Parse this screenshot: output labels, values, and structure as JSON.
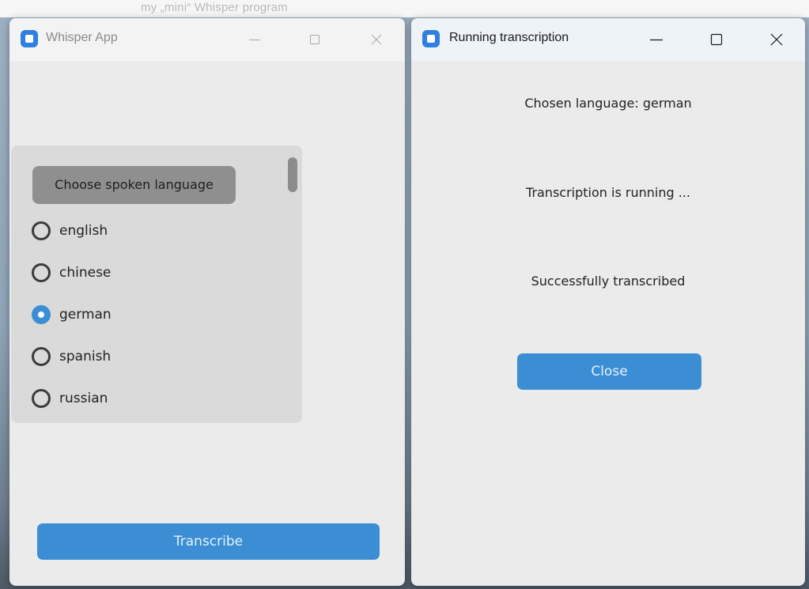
{
  "background_strip": {
    "text": "my „mini“ Whisper program"
  },
  "main_window": {
    "title": "Whisper App",
    "language_panel": {
      "header": "Choose spoken language",
      "options": [
        {
          "label": "english",
          "selected": false
        },
        {
          "label": "chinese",
          "selected": false
        },
        {
          "label": "german",
          "selected": true
        },
        {
          "label": "spanish",
          "selected": false
        },
        {
          "label": "russian",
          "selected": false
        }
      ]
    },
    "transcribe_button": "Transcribe"
  },
  "transcription_window": {
    "title": "Running transcription",
    "chosen_language": "Chosen language: german",
    "running_status": "Transcription is running ...",
    "result_status": "Successfully transcribed",
    "close_button": "Close"
  },
  "colors": {
    "accent": "#3b8ed4",
    "window_bg": "#ebebeb",
    "panel_bg": "#dadada",
    "header_bg": "#8f8f8f"
  },
  "icons": [
    "app-icon",
    "minimize-icon",
    "maximize-icon",
    "close-icon"
  ]
}
